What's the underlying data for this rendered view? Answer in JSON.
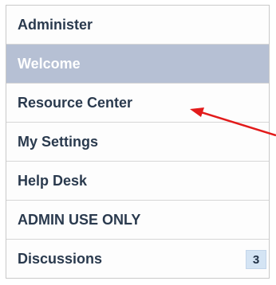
{
  "nav": {
    "items": [
      {
        "label": "Administer",
        "active": false
      },
      {
        "label": "Welcome",
        "active": true
      },
      {
        "label": "Resource Center",
        "active": false
      },
      {
        "label": "My Settings",
        "active": false
      },
      {
        "label": "Help Desk",
        "active": false
      },
      {
        "label": "ADMIN USE ONLY",
        "active": false
      },
      {
        "label": "Discussions",
        "active": false,
        "badge": "3"
      }
    ]
  },
  "colors": {
    "active_bg": "#b6c0d4",
    "item_text": "#2a3a4e",
    "badge_bg": "#d4e4f4",
    "annotation_arrow": "#e21b1b"
  }
}
